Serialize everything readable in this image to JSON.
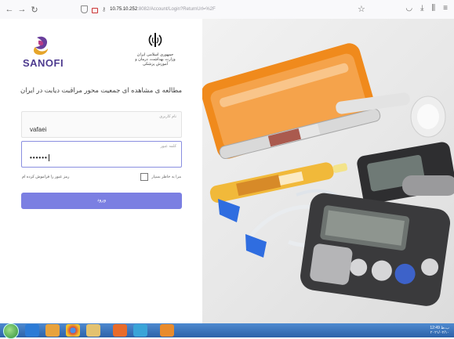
{
  "browser": {
    "url_host": "10.75.10.252",
    "url_path": ":8082/Account/Login?ReturnUrl=%2F",
    "icons": [
      "back-icon",
      "forward-icon",
      "reload-icon",
      "shield-icon",
      "lock-icon",
      "key-icon",
      "star-icon",
      "pocket-icon",
      "download-icon",
      "library-icon",
      "menu-icon"
    ]
  },
  "brand": {
    "name": "SANOFI"
  },
  "ministry": {
    "line1": "جمهوری اسلامی ایران",
    "line2": "وزارت بهداشت، درمان و آموزش پزشکی"
  },
  "form": {
    "title": "مطالعه ی مشاهده ای جمعیت محور مراقبت دیابت در ایران",
    "username_label": "نام کاربری",
    "username_value": "vafaei",
    "password_label": "کلمه عبور",
    "password_value": "••••••",
    "remember_label": "مرا به خاطر بسپار",
    "forgot_label": "رمز عبور را فراموش کرده ام",
    "submit_label": "ورود"
  },
  "colors": {
    "button": "#7b7fe2",
    "brand": "#4e3b8f",
    "focus_border": "#8a8fe0"
  },
  "taskbar": {
    "apps": [
      "start-button",
      "ie-icon",
      "media-player-icon",
      "chrome-icon",
      "explorer-icon",
      "firefox-icon",
      "network-app-icon",
      "office-app-icon"
    ],
    "clock_time": "12:49 ب.ظ",
    "clock_date": "۲۰۲۱/۰۲/۱۰"
  }
}
